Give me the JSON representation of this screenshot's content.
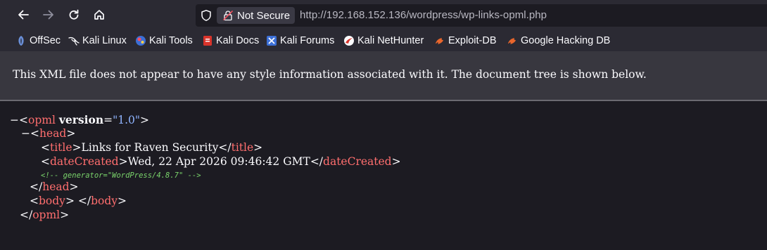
{
  "toolbar": {
    "security_label": "Not Secure",
    "url_host": "http://192.168.152.136",
    "url_path": "/wordpress/wp-links-opml.php"
  },
  "bookmarks": [
    {
      "label": "OffSec",
      "icon": "offsec-icon"
    },
    {
      "label": "Kali Linux",
      "icon": "kali-dragon-icon"
    },
    {
      "label": "Kali Tools",
      "icon": "kali-tools-icon"
    },
    {
      "label": "Kali Docs",
      "icon": "kali-docs-icon"
    },
    {
      "label": "Kali Forums",
      "icon": "kali-forums-icon"
    },
    {
      "label": "Kali NetHunter",
      "icon": "nethunter-icon"
    },
    {
      "label": "Exploit-DB",
      "icon": "exploit-db-icon"
    },
    {
      "label": "Google Hacking DB",
      "icon": "ghdb-icon"
    }
  ],
  "info_message": "This XML file does not appear to have any style information associated with it. The document tree is shown below.",
  "xml": {
    "opml_tag": "opml",
    "version_attr": "version",
    "version_value": "\"1.0\"",
    "head_tag": "head",
    "title_tag": "title",
    "title_text": "Links for Raven Security",
    "date_tag": "dateCreated",
    "date_text": "Wed, 22 Apr 2026 09:46:42 GMT",
    "comment": "<!-- generator=\"WordPress/4.8.7\" -->",
    "body_tag": "body"
  },
  "colors": {
    "tag": "#ff6e6e",
    "attr_value": "#8fb4ff",
    "comment": "#7ad46b",
    "background": "#1c1b22"
  }
}
